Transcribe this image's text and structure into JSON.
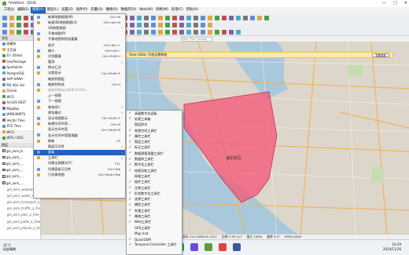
{
  "window": {
    "title": "*Untitled - QGIS",
    "controls": [
      "—",
      "□",
      "✕"
    ]
  },
  "menubar": [
    "工程(J)",
    "编辑(E)",
    "视图(V)",
    "图层(L)",
    "设置(S)",
    "插件(P)",
    "矢量(O)",
    "栅格(R)",
    "数据库(D)",
    "Web(W)",
    "网格(M)",
    "处理(C)",
    "帮助(H)"
  ],
  "search_placeholder": "Map Tiles Canada, Q...",
  "browser": {
    "title": "浏览",
    "items": [
      "收藏夹",
      "主目录",
      "D:\\ (Data)",
      "GeoPackage",
      "SpatiaLite",
      "PostgreSQL",
      "SAP HANA",
      "MS SQL Ser",
      "Oracle",
      "WCS",
      "ArcGIS REST",
      "MapBox",
      "WMS/WMTS",
      "Vector Tiles",
      "XYZ Tiles",
      "WCS",
      "WFS / OGC"
    ]
  },
  "layers": {
    "title": "图层",
    "items": [
      {
        "label": "gis_osm_b...",
        "checked": true,
        "sub": false
      },
      {
        "label": "gis_osm_...",
        "checked": true,
        "sub": false
      },
      {
        "label": "gis_osm_...",
        "checked": true,
        "sub": false
      },
      {
        "label": "gis_osm_...",
        "checked": true,
        "sub": false
      },
      {
        "label": "gis_osm_...",
        "checked": true,
        "sub": false
      },
      {
        "label": "gis_osm_...",
        "checked": true,
        "sub": false
      },
      {
        "label": "gis_osm_waterways_free_1",
        "checked": false,
        "sub": true
      },
      {
        "label": "gis_osm_water_a_free_1",
        "checked": false,
        "sub": true
      },
      {
        "label": "gis_osm_transport_a_free_1",
        "checked": false,
        "sub": true
      },
      {
        "label": "gis_osm_traffic_a_free_1",
        "checked": false,
        "sub": true
      },
      {
        "label": "gis_osm_pois_a_free_1",
        "checked": false,
        "sub": true
      },
      {
        "label": "gis_osm_pofw_a_free_1",
        "checked": false,
        "sub": true
      },
      {
        "label": "gis_osm_places_a_free_1",
        "checked": false,
        "sub": true
      }
    ]
  },
  "menu_view": [
    {
      "label": "新建地图视图(M)",
      "sc": "Ctrl+M",
      "arrow": false,
      "dis": false
    },
    {
      "label": "新建3D地图视图(3)",
      "sc": "Ctrl+Alt+M",
      "arrow": false,
      "dis": false
    },
    {
      "label": "3D地图视图",
      "sc": "",
      "arrow": true,
      "dis": false
    },
    {
      "label": "平移地图(P)",
      "sc": "",
      "arrow": false,
      "dis": false
    },
    {
      "label": "平移地图到所选要素",
      "sc": "",
      "arrow": false,
      "dis": false
    },
    {
      "label": "放大",
      "sc": "Ctrl+Alt++",
      "arrow": false,
      "dis": false
    },
    {
      "label": "缩小",
      "sc": "Ctrl+Alt+-",
      "arrow": false,
      "dis": false
    },
    {
      "label": "识别要素",
      "sc": "Ctrl+Shift+I",
      "arrow": false,
      "dis": false
    },
    {
      "label": "量测",
      "sc": "",
      "arrow": true,
      "dis": false
    },
    {
      "label": "统计汇总",
      "sc": "",
      "arrow": false,
      "dis": false
    },
    {
      "label": "全图显示",
      "sc": "Ctrl+Shift+F",
      "arrow": false,
      "dis": false
    },
    {
      "label": "缩放到图层",
      "sc": "",
      "arrow": false,
      "dis": false
    },
    {
      "label": "缩放到所选",
      "sc": "Ctrl+J",
      "arrow": false,
      "dis": false
    },
    {
      "label": "缩放到原始分辨率(100%)",
      "sc": "",
      "arrow": false,
      "dis": true
    },
    {
      "label": "上一视图",
      "sc": "",
      "arrow": false,
      "dis": false
    },
    {
      "label": "下一视图",
      "sc": "",
      "arrow": false,
      "dis": false
    },
    {
      "label": "装饰(D)",
      "sc": "",
      "arrow": true,
      "dis": false
    },
    {
      "label": "预览模式",
      "sc": "",
      "arrow": true,
      "dis": false
    },
    {
      "label": "显示地图提示",
      "sc": "Ctrl+Shift+T",
      "arrow": false,
      "dis": false
    },
    {
      "label": "新建空间书签...",
      "sc": "Ctrl+B",
      "arrow": false,
      "dis": false
    },
    {
      "label": "显示空间书签",
      "sc": "Ctrl+Shift+B",
      "arrow": false,
      "dis": false
    },
    {
      "label": "显示空间书签管理器",
      "sc": "",
      "arrow": false,
      "dis": false
    },
    {
      "label": "刷新",
      "sc": "F5",
      "arrow": false,
      "dis": false
    },
    {
      "label": "图层可见性",
      "sc": "",
      "arrow": true,
      "dis": false
    },
    {
      "label": "面板",
      "sc": "",
      "arrow": true,
      "dis": false,
      "hl": true
    },
    {
      "label": "工具栏",
      "sc": "",
      "arrow": true,
      "dis": false
    },
    {
      "label": "切换全屏模式(F)",
      "sc": "F11",
      "arrow": false,
      "dis": false
    },
    {
      "label": "切换面板可见性",
      "sc": "Ctrl+Tab",
      "arrow": false,
      "dis": false
    },
    {
      "label": "只切换地图",
      "sc": "Ctrl+Shift+Tab",
      "arrow": false,
      "dis": false
    }
  ],
  "menu_panels": [
    {
      "label": "高级数字化面板",
      "checked": true
    },
    {
      "label": "处理工具箱",
      "checked": true
    },
    {
      "label": "图层样式",
      "checked": false
    },
    {
      "label": "地理空间工具栏",
      "checked": true
    },
    {
      "label": "属性工具栏",
      "checked": true
    },
    {
      "label": "图层工具栏",
      "checked": true
    },
    {
      "label": "标注工具栏",
      "checked": true
    },
    {
      "label": "数据源管理器工具栏",
      "checked": true
    },
    {
      "label": "数据库工具栏",
      "checked": true
    },
    {
      "label": "数字化工具栏",
      "checked": true
    },
    {
      "label": "地图导航工具栏",
      "checked": true
    },
    {
      "label": "网格工具栏",
      "checked": false
    },
    {
      "label": "插件工具栏",
      "checked": true
    },
    {
      "label": "注释工具栏",
      "checked": true
    },
    {
      "label": "形状数字化工具栏",
      "checked": true
    },
    {
      "label": "选择工具栏",
      "checked": true
    },
    {
      "label": "捕捉工具栏",
      "checked": true
    },
    {
      "label": "矢量工具栏",
      "checked": true
    },
    {
      "label": "栅格工具栏",
      "checked": true
    },
    {
      "label": "Web工具栏",
      "checked": true
    },
    {
      "label": "GPS工具栏",
      "checked": false
    },
    {
      "label": "Map Inst",
      "checked": false
    },
    {
      "label": "QuickOSM",
      "checked": true
    },
    {
      "label": "Temporal Controller 工具栏",
      "checked": true
    }
  ],
  "infobar": {
    "text": "Open Data: 开放无需审阅",
    "button": "查看更新"
  },
  "map": {
    "district_label": "浦东新区"
  },
  "status": {
    "coord": "坐标 121.5496,31.2317",
    "scale": "比例 1:95 117",
    "mag": "放大 100%",
    "rot": "旋转 0.0°",
    "crs": "EPSG:4326"
  },
  "taskbar": {
    "weather_temp": "31°C",
    "weather_desc": "局部晴朗",
    "time": "16:29",
    "date": "2024/11/26"
  },
  "colors": {
    "accent": "#1f62c4",
    "highlight_poly": "#f45a78",
    "infobar": "#ffe9a8"
  }
}
